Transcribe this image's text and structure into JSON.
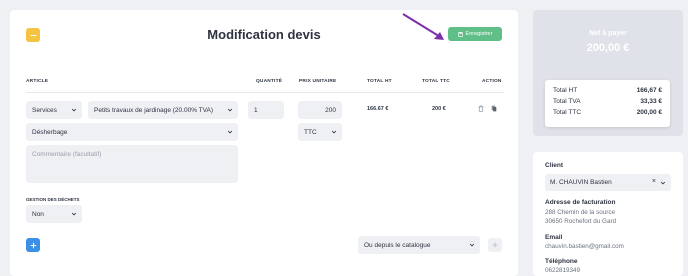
{
  "header": {
    "title": "Modification devis",
    "save_label": "Enregistrer"
  },
  "table": {
    "columns": {
      "article": "ARTICLE",
      "quantity": "QUANTITÉ",
      "unit_price": "PRIX UNITAIRE",
      "total_ht": "TOTAL HT",
      "total_ttc": "TOTAL TTC",
      "action": "ACTION"
    },
    "row": {
      "category": "Services",
      "product": "Petits travaux de jardinage (20.00% TVA)",
      "quantity": "1",
      "unit_price": "200",
      "total_ht": "166.67 €",
      "total_ttc": "200 €",
      "subproduct": "Désherbage",
      "price_mode": "TTC",
      "comment_placeholder": "Commentaire (facultatif)"
    }
  },
  "waste": {
    "label": "GESTION DES DÉCHETS",
    "value": "Non"
  },
  "catalog": {
    "label": "Ou depuis le catalogue"
  },
  "payment": {
    "title": "Net à payer",
    "amount": "200,00 €",
    "totals": [
      {
        "label": "Total HT",
        "value": "166,67 €"
      },
      {
        "label": "Total TVA",
        "value": "33,33 €"
      },
      {
        "label": "Total TTC",
        "value": "200,00 €"
      }
    ]
  },
  "client": {
    "label": "Client",
    "value": "M. CHAUVIN Bastien",
    "billing_label": "Adresse de facturation",
    "billing_line1": "288 Chemin de la source",
    "billing_line2": "30650 Rochefort du Gard",
    "email_label": "Email",
    "email": "chauvin.bastien@gmail.com",
    "phone_label": "Téléphone",
    "phone": "0622819349"
  },
  "colors": {
    "accent_yellow": "#f5c242",
    "save_green": "#5fbf87",
    "add_blue": "#3b8fe6",
    "arrow_purple": "#7b2fa8"
  },
  "icons": [
    "back-icon",
    "save-icon",
    "trash-icon",
    "copy-icon",
    "plus-icon",
    "chevron-down-icon",
    "clear-icon"
  ]
}
